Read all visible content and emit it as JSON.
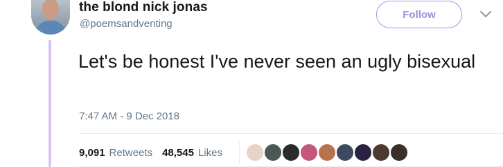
{
  "user": {
    "display_name": "the blond nick jonas",
    "handle": "@poemsandventing"
  },
  "follow_label": "Follow",
  "tweet": {
    "text": "Let's be honest I've never seen an ugly bisexual",
    "timestamp": "7:47 AM - 9 Dec 2018"
  },
  "stats": {
    "retweets_count": "9,091",
    "retweets_label": "Retweets",
    "likes_count": "48,545",
    "likes_label": "Likes"
  },
  "likers": [
    {
      "color": "#e8d3c4"
    },
    {
      "color": "#4a5a52"
    },
    {
      "color": "#2b2b2b"
    },
    {
      "color": "#c6567c"
    },
    {
      "color": "#b5744e"
    },
    {
      "color": "#3c4a5e"
    },
    {
      "color": "#2a2240"
    },
    {
      "color": "#4b3a30"
    },
    {
      "color": "#3b2f2a"
    }
  ],
  "colors": {
    "accent": "#a48bdf",
    "thread_line": "#d6c4f2",
    "secondary_text": "#657786"
  }
}
